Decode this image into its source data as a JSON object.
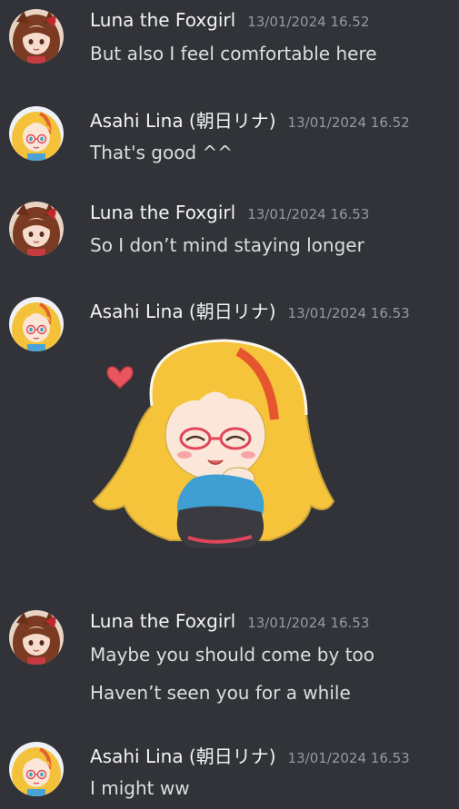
{
  "messages": [
    {
      "author": "Luna the Foxgirl",
      "timestamp": "13/01/2024 16.52",
      "lines": [
        "But also I feel comfortable here"
      ]
    },
    {
      "author": "Asahi Lina (朝日リナ)",
      "timestamp": "13/01/2024 16.52",
      "lines": [
        "That's good ^^"
      ]
    },
    {
      "author": "Luna the Foxgirl",
      "timestamp": "13/01/2024 16.53",
      "lines": [
        "So I don’t mind staying longer"
      ]
    },
    {
      "author": "Asahi Lina (朝日リナ)",
      "timestamp": "13/01/2024 16.53",
      "lines": []
    },
    {
      "author": "Luna the Foxgirl",
      "timestamp": "13/01/2024 16.53",
      "lines": [
        "Maybe you should come by too",
        "Haven’t seen you for a while"
      ]
    },
    {
      "author": "Asahi Lina (朝日リナ)",
      "timestamp": "13/01/2024 16.53",
      "lines": [
        "I might ww"
      ]
    }
  ],
  "icons": {
    "luna_avatar": "luna-avatar-icon",
    "lina_avatar": "lina-avatar-icon",
    "sticker": "heart-girl-sticker"
  },
  "colors": {
    "background": "#313338",
    "author": "#f2f3f5",
    "timestamp": "#949ba4",
    "message_text": "#dbdee1"
  }
}
